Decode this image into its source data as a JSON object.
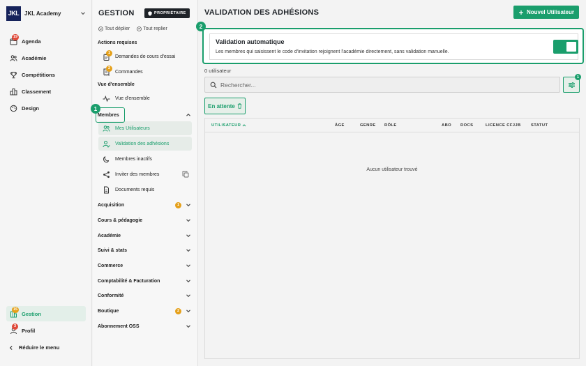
{
  "brand": {
    "logo": "JKL",
    "name": "JKL Academy"
  },
  "nav": {
    "items": [
      {
        "label": "Agenda",
        "icon": "calendar-icon",
        "badge": "19"
      },
      {
        "label": "Académie",
        "icon": "users-icon"
      },
      {
        "label": "Compétitions",
        "icon": "trophy-icon"
      },
      {
        "label": "Classement",
        "icon": "ranking-icon"
      },
      {
        "label": "Design",
        "icon": "palette-icon"
      }
    ],
    "bottom": [
      {
        "label": "Gestion",
        "icon": "building-icon",
        "badge": "15",
        "active": true
      },
      {
        "label": "Profil",
        "icon": "user-icon",
        "badge": "3"
      }
    ],
    "reduce_label": "Réduire le menu"
  },
  "mid": {
    "title": "GESTION",
    "owner_badge": "PROPRIÉTAIRE",
    "expand_all": "Tout déplier",
    "collapse_all": "Tout replier",
    "actions_head": "Actions requises",
    "actions": [
      {
        "label": "Demandes de cours d'essai",
        "badge": "1"
      },
      {
        "label": "Commandes",
        "badge": "2"
      }
    ],
    "overview_head": "Vue d'ensemble",
    "overview_item": "Vue d'ensemble",
    "membres_label": "Membres",
    "membres_items": [
      {
        "label": "Mes Utilisateurs"
      },
      {
        "label": "Validation des adhésions"
      },
      {
        "label": "Membres inactifs"
      },
      {
        "label": "Inviter des membres"
      },
      {
        "label": "Documents requis"
      }
    ],
    "groups": [
      {
        "label": "Acquisition",
        "badge": "1"
      },
      {
        "label": "Cours & pédagogie"
      },
      {
        "label": "Académie"
      },
      {
        "label": "Suivi & stats"
      },
      {
        "label": "Commerce"
      },
      {
        "label": "Comptabilité & Facturation"
      },
      {
        "label": "Conformité"
      },
      {
        "label": "Boutique",
        "badge": "2"
      },
      {
        "label": "Abonnement OSS"
      }
    ],
    "step1": "1"
  },
  "main": {
    "title": "VALIDATION DES ADHÉSIONS",
    "new_user_label": "Nouvel Utilisateur",
    "step2": "2",
    "auto": {
      "title": "Validation automatique",
      "description": "Les membres qui saisissent le code d'invitation rejoignent l'académie directement, sans validation manuelle.",
      "enabled": true
    },
    "user_count": "0 utilisateur",
    "search_placeholder": "Rechercher...",
    "filter_badge": "1",
    "pending_label": "En attente",
    "columns": [
      "UTILISATEUR",
      "ÂGE",
      "GENRE",
      "RÔLE",
      "ABO",
      "DOCS",
      "LICENCE CFJJB",
      "STATUT"
    ],
    "empty_text": "Aucun utilisateur trouvé"
  },
  "colors": {
    "accent": "#1a9e6c",
    "badge_red": "#e04a3a",
    "badge_orange": "#e5a01a",
    "logo_bg": "#16235b"
  }
}
